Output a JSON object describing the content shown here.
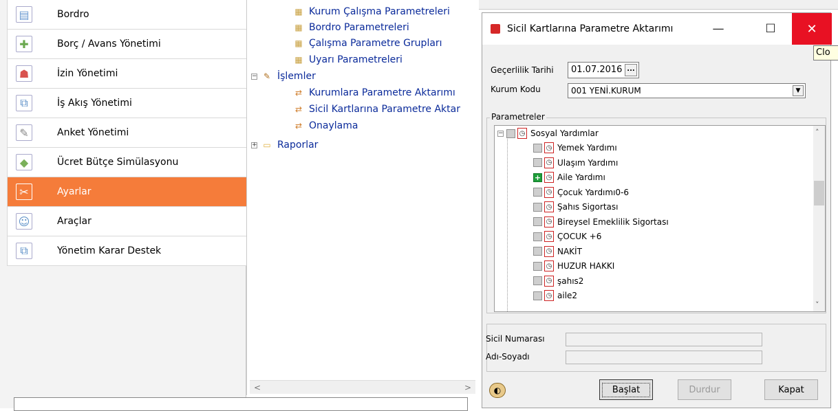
{
  "nav": {
    "items": [
      {
        "label": "Bordro",
        "icon": "payroll-icon",
        "color": "#6b9bd1"
      },
      {
        "label": "Borç / Avans Yönetimi",
        "icon": "debt-advance-icon",
        "color": "#6aa84f"
      },
      {
        "label": "İzin Yönetimi",
        "icon": "leave-icon",
        "color": "#d9534f"
      },
      {
        "label": "İş Akış Yönetimi",
        "icon": "workflow-icon",
        "color": "#5b8fc7"
      },
      {
        "label": "Anket Yönetimi",
        "icon": "survey-icon",
        "color": "#888888"
      },
      {
        "label": "Ücret Bütçe Simülasyonu",
        "icon": "budget-sim-icon",
        "color": "#7ab05a"
      },
      {
        "label": "Ayarlar",
        "icon": "settings-icon",
        "color": "#ffffff",
        "active": true
      },
      {
        "label": "Araçlar",
        "icon": "tools-icon",
        "color": "#5b8fc7"
      },
      {
        "label": "Yönetim Karar Destek",
        "icon": "decision-support-icon",
        "color": "#5b8fc7"
      }
    ]
  },
  "tree": {
    "items": [
      {
        "label": "Kurum Çalışma Parametreleri",
        "icon": "grid-icon"
      },
      {
        "label": "Bordro Parametreleri",
        "icon": "grid-icon"
      },
      {
        "label": "Çalışma Parametre Grupları",
        "icon": "grid-icon"
      },
      {
        "label": "Uyarı Parametreleri",
        "icon": "grid-icon"
      },
      {
        "label": "İşlemler",
        "icon": "tools-icon"
      },
      {
        "label": "Kurumlara Parametre Aktarımı",
        "icon": "transfer-icon"
      },
      {
        "label": "Sicil Kartlarına Parametre Aktar",
        "icon": "transfer-icon"
      },
      {
        "label": "Onaylama",
        "icon": "transfer-icon"
      },
      {
        "label": "Raporlar",
        "icon": "folder-icon"
      }
    ]
  },
  "dialog": {
    "title": "Sicil Kartlarına Parametre Aktarımı",
    "tooltip": "Clo",
    "date_label": "Geçerlilik Tarihi",
    "date_value": "01.07.2016",
    "date_button": "...",
    "kurum_label": "Kurum Kodu",
    "kurum_value": "001 YENİ.KURUM",
    "params_label": "Parametreler",
    "params_root": "Sosyal Yardımlar",
    "params": [
      {
        "label": "Yemek Yardımı",
        "checked": false
      },
      {
        "label": "Ulaşım Yardımı",
        "checked": false
      },
      {
        "label": "Aile Yardımı",
        "checked": true
      },
      {
        "label": "Çocuk Yardımı0-6",
        "checked": false
      },
      {
        "label": "Şahıs Sigortası",
        "checked": false
      },
      {
        "label": "Bireysel Emeklilik Sigortası",
        "checked": false
      },
      {
        "label": "ÇOCUK +6",
        "checked": false
      },
      {
        "label": "NAKİT",
        "checked": false
      },
      {
        "label": "HUZUR HAKKI",
        "checked": false
      },
      {
        "label": "şahıs2",
        "checked": false
      },
      {
        "label": "aile2",
        "checked": false
      }
    ],
    "sicil_label": "Sicil Numarası",
    "name_label": "Adı-Soyadı",
    "btn_start": "Başlat",
    "btn_stop": "Durdur",
    "btn_close": "Kapat"
  }
}
